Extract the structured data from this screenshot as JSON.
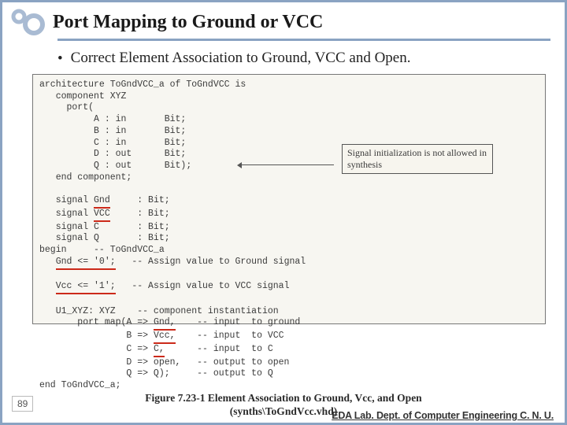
{
  "title": "Port Mapping to Ground or VCC",
  "bullet": {
    "marker": "•",
    "text": "Correct Element Association to Ground, VCC and Open."
  },
  "code": {
    "line01": "architecture ToGndVCC_a of ToGndVCC is",
    "line02": "   component XYZ",
    "line03": "     port(",
    "line04": "          A : in       Bit;",
    "line05": "          B : in       Bit;",
    "line06": "          C : in       Bit;",
    "line07": "          D : out      Bit;",
    "line08": "          Q : out      Bit);",
    "line09": "   end component;",
    "line10_a": "   signal ",
    "line10_b": "Gnd",
    "line10_c": "     : Bit;",
    "line11_a": "   signal ",
    "line11_b": "VCC",
    "line11_c": "     : Bit;",
    "line12": "   signal C       : Bit;",
    "line13": "   signal Q       : Bit;",
    "line14": "begin     -- ToGndVCC_a",
    "line15_a": "   ",
    "line15_b": "Gnd <= '0';",
    "line15_c": "   -- Assign value to Ground signal",
    "line16_a": "   ",
    "line16_b": "Vcc <= '1';",
    "line16_c": "   -- Assign value to VCC signal",
    "line17": "   U1_XYZ: XYZ    -- component instantiation",
    "line18_a": "       port map(A => ",
    "line18_b": "Gnd,",
    "line18_c": "    -- input  to ground",
    "line19_a": "                B => ",
    "line19_b": "Vcc,",
    "line19_c": "    -- input  to VCC",
    "line20_a": "                C => ",
    "line20_b": "C,",
    "line20_c": "      -- input  to C",
    "line21": "                D => open,   -- output to open",
    "line22": "                Q => Q);     -- output to Q",
    "line23": "end ToGndVCC_a;"
  },
  "callout": "Signal initialization is not allowed in synthesis",
  "caption_line1": "Figure 7.23-1 Element Association to Ground, Vcc, and Open",
  "caption_line2": "(synths\\ToGndVcc.vhd)",
  "page_number": "89",
  "footer": "EDA Lab. Dept. of Computer Engineering C. N. U."
}
